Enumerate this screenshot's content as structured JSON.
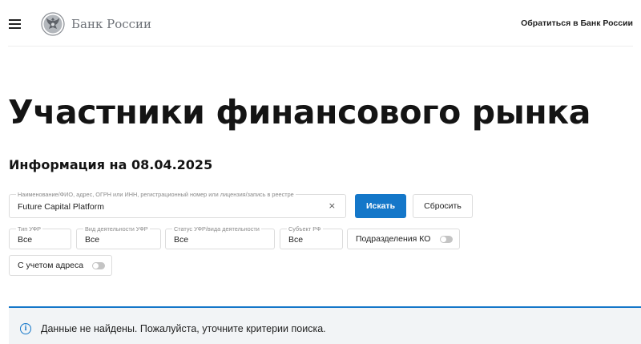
{
  "header": {
    "logo_text": "Банк России",
    "contact_link": "Обратиться в Банк России"
  },
  "page": {
    "title": "Участники финансового рынка",
    "info_date": "Информация на 08.04.2025"
  },
  "search": {
    "label": "Наименование/ФИО, адрес, ОГРН или ИНН, регистрационный номер или лицензия/запись в реестре",
    "value": "Future Capital Platform",
    "clear_symbol": "×",
    "search_button": "Искать",
    "reset_button": "Сбросить"
  },
  "filters": {
    "type": {
      "label": "Тип УФР",
      "value": "Все"
    },
    "activity": {
      "label": "Вид деятельности УФР",
      "value": "Все"
    },
    "status": {
      "label": "Статус УФР/вида деятельности",
      "value": "Все"
    },
    "region": {
      "label": "Субъект РФ",
      "value": "Все"
    }
  },
  "toggles": {
    "branches": {
      "label": "Подразделения КО",
      "on": false
    },
    "address": {
      "label": "С учетом адреса",
      "on": false
    }
  },
  "notice": {
    "icon": "info-icon",
    "icon_glyph": "i",
    "text": "Данные не найдены. Пожалуйста, уточните критерии поиска."
  },
  "colors": {
    "accent": "#1477c9",
    "notice_bg": "#f2f4f6",
    "toggle_off": "#c4c4c4"
  }
}
